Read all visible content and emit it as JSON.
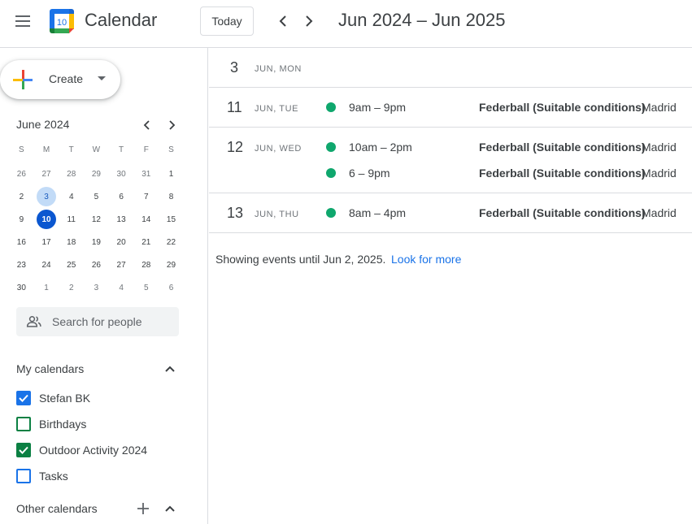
{
  "header": {
    "app_title": "Calendar",
    "logo_day": "10",
    "today_label": "Today",
    "range_title": "Jun 2024 – Jun 2025"
  },
  "sidebar": {
    "create_label": "Create",
    "mini_calendar": {
      "month_label": "June 2024",
      "weekdays": [
        "S",
        "M",
        "T",
        "W",
        "T",
        "F",
        "S"
      ],
      "weeks": [
        [
          "26",
          "27",
          "28",
          "29",
          "30",
          "31",
          "1"
        ],
        [
          "2",
          "3",
          "4",
          "5",
          "6",
          "7",
          "8"
        ],
        [
          "9",
          "10",
          "11",
          "12",
          "13",
          "14",
          "15"
        ],
        [
          "16",
          "17",
          "18",
          "19",
          "20",
          "21",
          "22"
        ],
        [
          "23",
          "24",
          "25",
          "26",
          "27",
          "28",
          "29"
        ],
        [
          "30",
          "1",
          "2",
          "3",
          "4",
          "5",
          "6"
        ]
      ]
    },
    "search_people_placeholder": "Search for people",
    "my_calendars": {
      "title": "My calendars",
      "items": [
        {
          "label": "Stefan BK",
          "checked": true,
          "color": "#1a73e8"
        },
        {
          "label": "Birthdays",
          "checked": false,
          "color": "#0b8043"
        },
        {
          "label": "Outdoor Activity 2024",
          "checked": true,
          "color": "#0b8043"
        },
        {
          "label": "Tasks",
          "checked": false,
          "color": "#1a73e8"
        }
      ]
    },
    "other_calendars": {
      "title": "Other calendars"
    }
  },
  "agenda": {
    "days": [
      {
        "num": "3",
        "label": "JUN, MON",
        "events": []
      },
      {
        "num": "11",
        "label": "JUN, TUE",
        "events": [
          {
            "time": "9am – 9pm",
            "title": "Federball (Suitable conditions)",
            "location": "Madrid"
          }
        ]
      },
      {
        "num": "12",
        "label": "JUN, WED",
        "events": [
          {
            "time": "10am – 2pm",
            "title": "Federball (Suitable conditions)",
            "location": "Madrid"
          },
          {
            "time": "6 – 9pm",
            "title": "Federball (Suitable conditions)",
            "location": "Madrid"
          }
        ]
      },
      {
        "num": "13",
        "label": "JUN, THU",
        "events": [
          {
            "time": "8am – 4pm",
            "title": "Federball (Suitable conditions)",
            "location": "Madrid"
          }
        ]
      }
    ],
    "footer_text": "Showing events until Jun 2, 2025.",
    "footer_link": "Look for more"
  },
  "colors": {
    "event_dot": "#0fa76d",
    "today_bg": "#0b57d0",
    "selected_bg": "#c2dbf7",
    "link": "#1a73e8"
  }
}
